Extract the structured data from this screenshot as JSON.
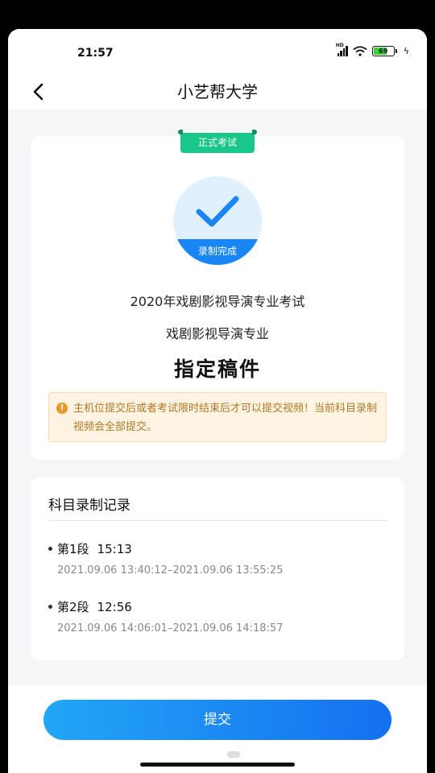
{
  "status_bar": {
    "time": "21:57",
    "network_label": "HD",
    "battery_level": "69",
    "battery_percent": 69
  },
  "nav": {
    "title": "小艺帮大学",
    "back_icon": "chevron-left-icon"
  },
  "exam": {
    "tag": "正式考试",
    "record_status": "录制完成",
    "exam_name": "2020年戏剧影视导演专业考试",
    "major": "戏剧影视导演专业",
    "subject": "指定稿件",
    "notice": "主机位提交后或者考试限时结束后才可以提交视频！当前科目录制视频会全部提交。"
  },
  "records": {
    "title": "科目录制记录",
    "items": [
      {
        "label": "第1段",
        "duration": "15:13",
        "range": "2021.09.06 13:40:12–2021.09.06 13:55:25"
      },
      {
        "label": "第2段",
        "duration": "12:56",
        "range": "2021.09.06 14:06:01–2021.09.06 14:18:57"
      }
    ]
  },
  "actions": {
    "submit_label": "提交"
  },
  "colors": {
    "accent": "#1a86f5",
    "tag_green": "#19c78a",
    "notice_text": "#b07a24",
    "notice_bg": "#fdf3e3"
  }
}
